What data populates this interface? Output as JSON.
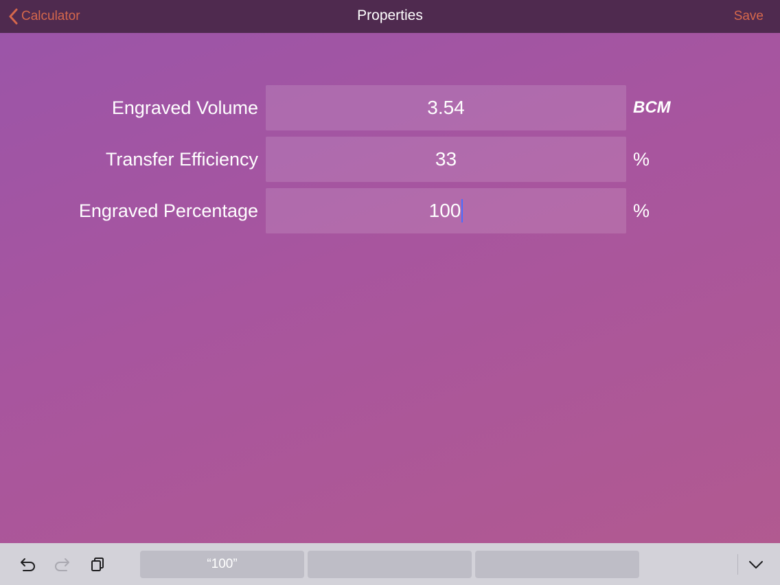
{
  "navbar": {
    "back_label": "Calculator",
    "title": "Properties",
    "save_label": "Save",
    "back_icon": "chevron-left-icon"
  },
  "form": {
    "rows": [
      {
        "label": "Engraved Volume",
        "value": "3.54",
        "unit": "BCM"
      },
      {
        "label": "Transfer Efficiency",
        "value": "33",
        "unit": "%"
      },
      {
        "label": "Engraved Percentage",
        "value": "100",
        "unit": "%"
      }
    ]
  },
  "keyboard_bar": {
    "icons": [
      "undo-icon",
      "redo-icon",
      "paste-icon",
      "dismiss-keyboard-icon"
    ],
    "suggestions": [
      "“100”",
      "",
      ""
    ]
  },
  "colors": {
    "accent": "#d6684c",
    "navbar_bg": "#4f2a4f",
    "caret": "#4a6cff"
  }
}
